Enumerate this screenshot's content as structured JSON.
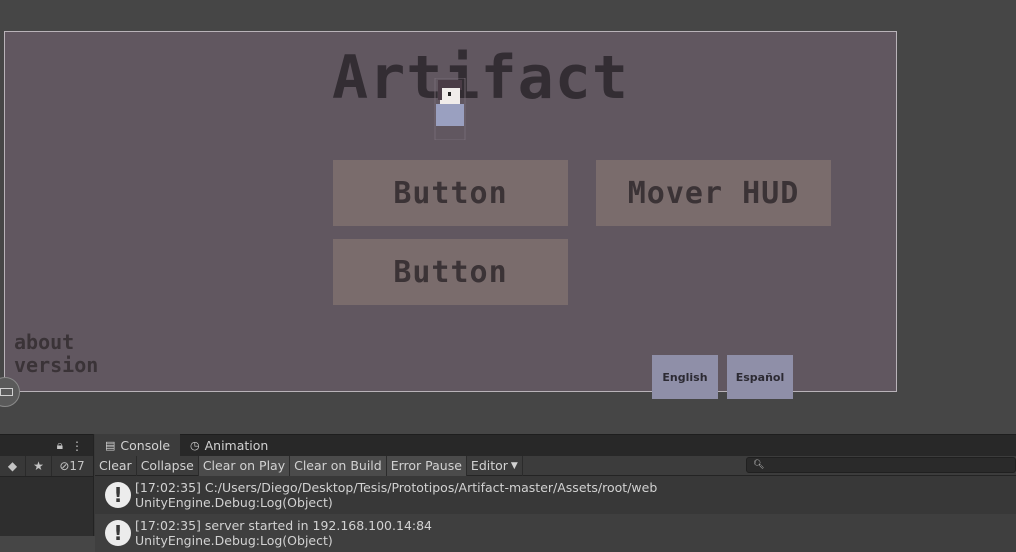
{
  "game": {
    "title": "Artifact",
    "buttons": [
      "Button",
      "Mover HUD",
      "Button"
    ],
    "about_lines": [
      "about",
      "version"
    ],
    "languages": [
      "English",
      "Español"
    ]
  },
  "left_panel": {
    "lock_icon": "lock-icon",
    "menu_icon": "kebab-menu-icon",
    "hidden_count": "17"
  },
  "console": {
    "tabs": [
      {
        "label": "Console",
        "icon": "console-icon"
      },
      {
        "label": "Animation",
        "icon": "animation-icon"
      }
    ],
    "toolbar": [
      "Clear",
      "Collapse",
      "Clear on Play",
      "Clear on Build",
      "Error Pause",
      "Editor"
    ],
    "search_icon": "search-icon",
    "logs": [
      {
        "line1": "[17:02:35] C:/Users/Diego/Desktop/Tesis/Prototipos/Artifact-master/Assets/root/web",
        "line2": "UnityEngine.Debug:Log(Object)"
      },
      {
        "line1": "[17:02:35] server started in 192.168.100.14:84",
        "line2": "UnityEngine.Debug:Log(Object)"
      }
    ]
  }
}
